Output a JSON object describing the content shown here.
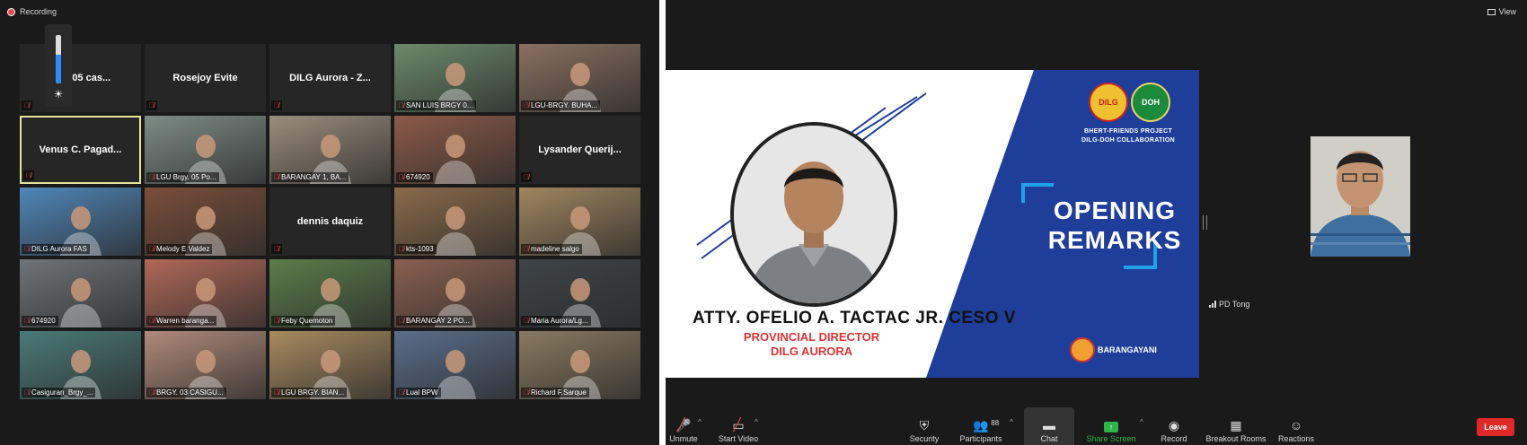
{
  "left_window": {
    "recording_label": "Recording",
    "volume_level": 0.6,
    "tiles": [
      {
        "name": "...ay 05 cas...",
        "label": "",
        "video": false
      },
      {
        "name": "Rosejoy Evite",
        "label": "",
        "video": false
      },
      {
        "name": "DILG Aurora - Z...",
        "label": "",
        "video": false
      },
      {
        "name": "",
        "label": "SAN LUIS BRGY 0...",
        "video": true,
        "bg": "#6b8a6a"
      },
      {
        "name": "",
        "label": "LGU-BRGY. BUHA...",
        "video": true,
        "bg": "#8a7060"
      },
      {
        "name": "Venus  C. Pagad...",
        "label": "",
        "video": false,
        "active": true
      },
      {
        "name": "",
        "label": "LGU Brgy. 05 Po...",
        "video": true,
        "bg": "#7d8c86"
      },
      {
        "name": "",
        "label": "BARANGAY 1, BA...",
        "video": true,
        "bg": "#9a8d7c"
      },
      {
        "name": "",
        "label": "674920",
        "video": true,
        "bg": "#8c5a48"
      },
      {
        "name": "Lysander  Querij...",
        "label": "",
        "video": false
      },
      {
        "name": "",
        "label": "DILG Aurora FAS",
        "video": true,
        "bg": "#4f86b8"
      },
      {
        "name": "",
        "label": "Melody E Valdez",
        "video": true,
        "bg": "#7a4e3a"
      },
      {
        "name": "dennis daquiz",
        "label": "",
        "video": false
      },
      {
        "name": "",
        "label": "kts-1093",
        "video": true,
        "bg": "#8a6a4a"
      },
      {
        "name": "",
        "label": "madeline salgo",
        "video": true,
        "bg": "#a08660"
      },
      {
        "name": "",
        "label": "674920",
        "video": true,
        "bg": "#6f7478"
      },
      {
        "name": "",
        "label": "Warren baranga...",
        "video": true,
        "bg": "#b06858"
      },
      {
        "name": "",
        "label": "Feby Quemoton",
        "video": true,
        "bg": "#5b7d4a"
      },
      {
        "name": "",
        "label": "BARANGAY 2 PO...",
        "video": true,
        "bg": "#8a6050"
      },
      {
        "name": "",
        "label": "Maria Aurora/Lg...",
        "video": true,
        "bg": "#3e4448"
      },
      {
        "name": "",
        "label": "Casiguran_Brgy_...",
        "video": true,
        "bg": "#4a7a78"
      },
      {
        "name": "",
        "label": "BRGY. 03 CASIGU...",
        "video": true,
        "bg": "#b08a7a"
      },
      {
        "name": "",
        "label": "LGU BRGY. BIAN...",
        "video": true,
        "bg": "#a88a60"
      },
      {
        "name": "",
        "label": "Lual BPW",
        "video": true,
        "bg": "#5a6e8a"
      },
      {
        "name": "",
        "label": "Richard F.Sarque",
        "video": true,
        "bg": "#8a7a60"
      }
    ]
  },
  "right_window": {
    "view_label": "View",
    "slide": {
      "logo_left": "DILG",
      "logo_right": "DOH",
      "project_line1": "BHERT-FRIENDS PROJECT",
      "project_line2": "DILG-DOH COLLABORATION",
      "heading_line1": "OPENING",
      "heading_line2": "REMARKS",
      "speaker_name": "ATTY. OFELIO A. TACTAC JR. CESO V",
      "speaker_title1": "PROVINCIAL DIRECTOR",
      "speaker_title2": "DILG AURORA",
      "brand": "BARANGAYANI"
    },
    "camera_label": "PD Tong",
    "toolbar": {
      "unmute": "Unmute",
      "start_video": "Start Video",
      "security": "Security",
      "participants": "Participants",
      "participants_count": "88",
      "chat": "Chat",
      "share_screen": "Share Screen",
      "record": "Record",
      "breakout_rooms": "Breakout Rooms",
      "reactions": "Reactions",
      "leave": "Leave"
    }
  }
}
